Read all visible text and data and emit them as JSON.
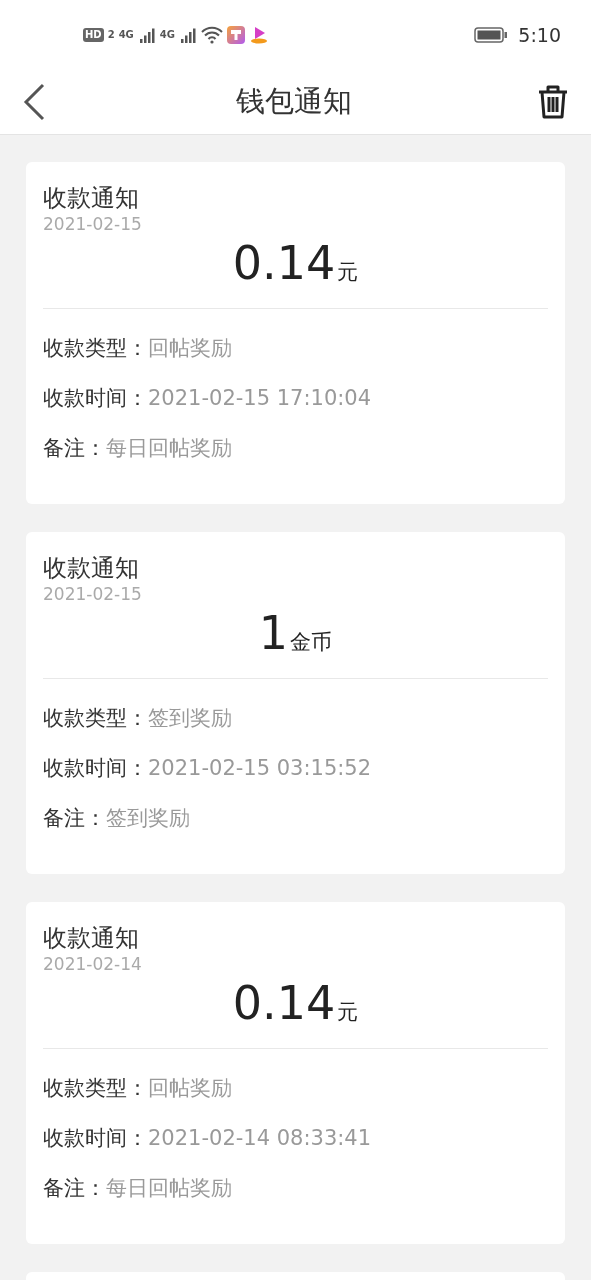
{
  "status_bar": {
    "hd": "HD",
    "sim_badge": "2",
    "network_1": "4G",
    "network_2": "4G",
    "time": "5:10"
  },
  "header": {
    "title": "钱包通知"
  },
  "notices": [
    {
      "title": "收款通知",
      "date": "2021-02-15",
      "amount": "0.14",
      "unit": "元",
      "fields": [
        {
          "label": "收款类型：",
          "value": "回帖奖励"
        },
        {
          "label": "收款时间：",
          "value": "2021-02-15 17:10:04"
        },
        {
          "label": "备注：",
          "value": "每日回帖奖励"
        }
      ]
    },
    {
      "title": "收款通知",
      "date": "2021-02-15",
      "amount": "1",
      "unit": "金币",
      "fields": [
        {
          "label": "收款类型：",
          "value": "签到奖励"
        },
        {
          "label": "收款时间：",
          "value": "2021-02-15 03:15:52"
        },
        {
          "label": "备注：",
          "value": "签到奖励"
        }
      ]
    },
    {
      "title": "收款通知",
      "date": "2021-02-14",
      "amount": "0.14",
      "unit": "元",
      "fields": [
        {
          "label": "收款类型：",
          "value": "回帖奖励"
        },
        {
          "label": "收款时间：",
          "value": "2021-02-14 08:33:41"
        },
        {
          "label": "备注：",
          "value": "每日回帖奖励"
        }
      ]
    }
  ]
}
